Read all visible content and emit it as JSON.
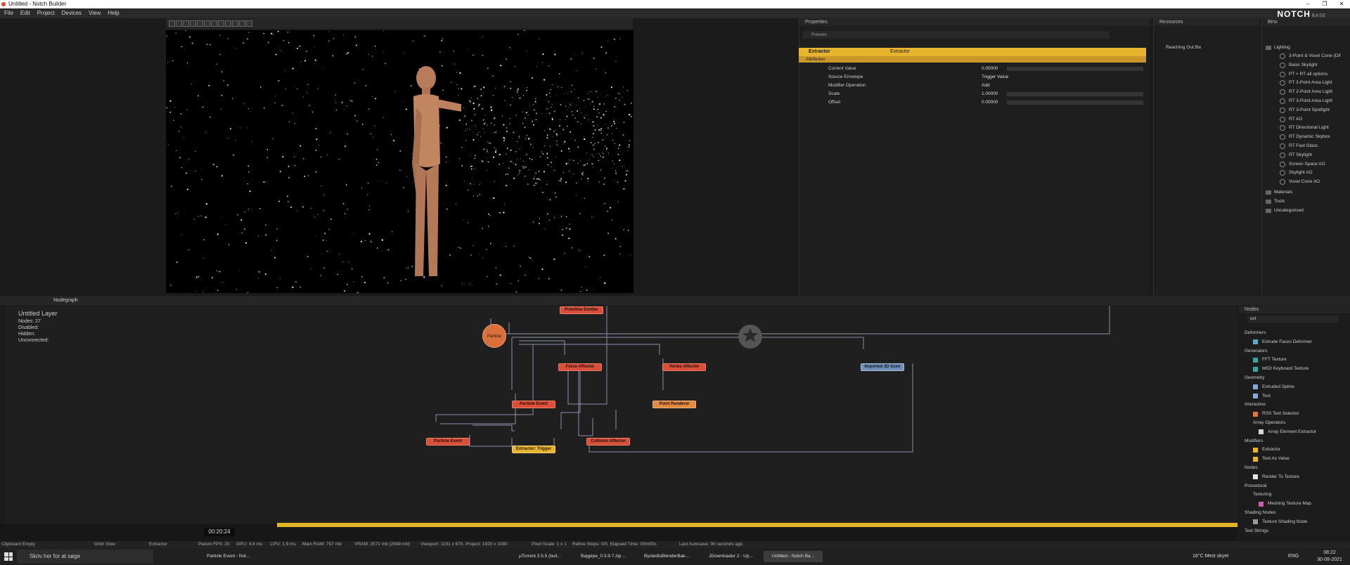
{
  "window": {
    "title": "Untitled - Notch Builder",
    "controls": [
      "–",
      "❐",
      "✕"
    ]
  },
  "menu": [
    "File",
    "Edit",
    "Project",
    "Devices",
    "View",
    "Help"
  ],
  "brand": {
    "logo": "NOTCH",
    "edition": "BASE"
  },
  "properties": {
    "title": "Properties",
    "presets_label": "Presets",
    "node_name": "Extractor",
    "node_type": "Extractor",
    "section": "Attributes",
    "rows": [
      {
        "label": "Current Value",
        "value": "0.00000"
      },
      {
        "label": "Source Envelope",
        "value": "Trigger Value"
      },
      {
        "label": "Modifier Operation",
        "value": "Add"
      },
      {
        "label": "Scale",
        "value": "1.00000"
      },
      {
        "label": "Offset",
        "value": "0.00000"
      }
    ]
  },
  "resources": {
    "title": "Resources",
    "items": [
      "Reaching Out.fbx"
    ]
  },
  "bins": {
    "title": "Bins",
    "lighting_label": "Lighting",
    "lighting": [
      "3-Point & Voxel Cone (Dif",
      "Basic Skylight",
      "PT + RT all options",
      "PT 3-Point Area Light",
      "RT 2-Point Area Light",
      "RT 3-Point Area Light",
      "RT 3-Point Spotlight",
      "RT AO",
      "RT Directional Light",
      "RT Dynamic Skybox",
      "RT Fast Glass",
      "RT Skylight",
      "Screen Space AO",
      "Skylight AO",
      "Voxel Cone AO"
    ],
    "other_cats": [
      "Materials",
      "Tools",
      "Uncategorised"
    ]
  },
  "nodegraph": {
    "tab": "Nodegraph",
    "layer_label": "Untitled Layer",
    "stats": [
      {
        "label": "Nodes:",
        "value": "27"
      },
      {
        "label": "Disabled:",
        "value": ""
      },
      {
        "label": "Hidden:",
        "value": ""
      },
      {
        "label": "Unconnected:",
        "value": ""
      }
    ],
    "nodes": {
      "emitter": "Primitive Emitter",
      "particle": "Particle",
      "force": "Force Affector",
      "vortex": "Vortex Affector",
      "imported": "Imported 3D Scen",
      "event1": "Particle Event",
      "point": "Point Renderer",
      "event2": "Particle Event",
      "extractor": "Extractor: Trigger",
      "collision": "Collision Affector"
    }
  },
  "nodes_panel": {
    "title": "Nodes",
    "search": "ext",
    "entries": [
      {
        "text": "Deformers",
        "kind": "cat"
      },
      {
        "text": "Extrude Faces Deformer",
        "kind": "item",
        "color": "#5aa9c9"
      },
      {
        "text": "Generators",
        "kind": "cat"
      },
      {
        "text": "FFT Texture",
        "kind": "item",
        "color": "#3fa59a"
      },
      {
        "text": "MIDI Keyboard Texture",
        "kind": "item",
        "color": "#3fa59a"
      },
      {
        "text": "Geometry",
        "kind": "cat"
      },
      {
        "text": "Extruded Spline",
        "kind": "item",
        "color": "#8aa7d6"
      },
      {
        "text": "Text",
        "kind": "item",
        "color": "#8aa7d6"
      },
      {
        "text": "Interactive",
        "kind": "cat"
      },
      {
        "text": "RSS Text Selector",
        "kind": "item",
        "color": "#e07b3c"
      },
      {
        "text": "Array Operators",
        "kind": "sub"
      },
      {
        "text": "Array Element Extractor",
        "kind": "item2",
        "color": "#d8d8d8"
      },
      {
        "text": "Modifiers",
        "kind": "cat"
      },
      {
        "text": "Extractor",
        "kind": "item",
        "color": "#e7b42d"
      },
      {
        "text": "Text As Value",
        "kind": "item",
        "color": "#e7b42d"
      },
      {
        "text": "Nodes",
        "kind": "cat"
      },
      {
        "text": "Render To Texture",
        "kind": "item",
        "color": "#e6e6e6"
      },
      {
        "text": "Procedural",
        "kind": "cat"
      },
      {
        "text": "Texturing",
        "kind": "sub"
      },
      {
        "text": "Meshing Texture Map",
        "kind": "item2",
        "color": "#c65fb0"
      },
      {
        "text": "Shading Nodes",
        "kind": "cat"
      },
      {
        "text": "Texture Shading Node",
        "kind": "item",
        "color": "#9a9a9a"
      },
      {
        "text": "Text Strings",
        "kind": "cat"
      }
    ]
  },
  "timeline": {
    "time": "00:20:24"
  },
  "status": {
    "clipboard": "Clipboard Empty",
    "view": "Orbit View",
    "selection": "Extractor",
    "parent_fps": "Parent FPS: 20",
    "gpu": "GPU: 4.6 ms",
    "cpu": "CPU: 1.9 ms",
    "ram": "Main RAM: 707 mb",
    "vram": "VRAM: 2571 mb (2948 mb)",
    "viewport": "Viewport: 1191 x 670, Project: 1920 x 1080",
    "pixel_scale": "Pixel Scale: 1 x 1",
    "refine": "Refine Steps: 0/0, Elapsed Time: 00m00s",
    "autosave": "Last Autosave: 90 seconds ago"
  },
  "taskbar": {
    "search_placeholder": "Skriv her for at søge",
    "apps": [
      "Particle Event - Not...",
      "µTorrent 3.5.5 (buil...",
      "Bagpipe_0.3.9.7.zip ...",
      "BystedtsBlenderBak...",
      "JDownloader 2 - Up...",
      "Untitled - Notch Ba..."
    ],
    "weather": "16°C  Mest skyet",
    "lang": "ENG",
    "time": "08:22",
    "date": "30-08-2021"
  }
}
